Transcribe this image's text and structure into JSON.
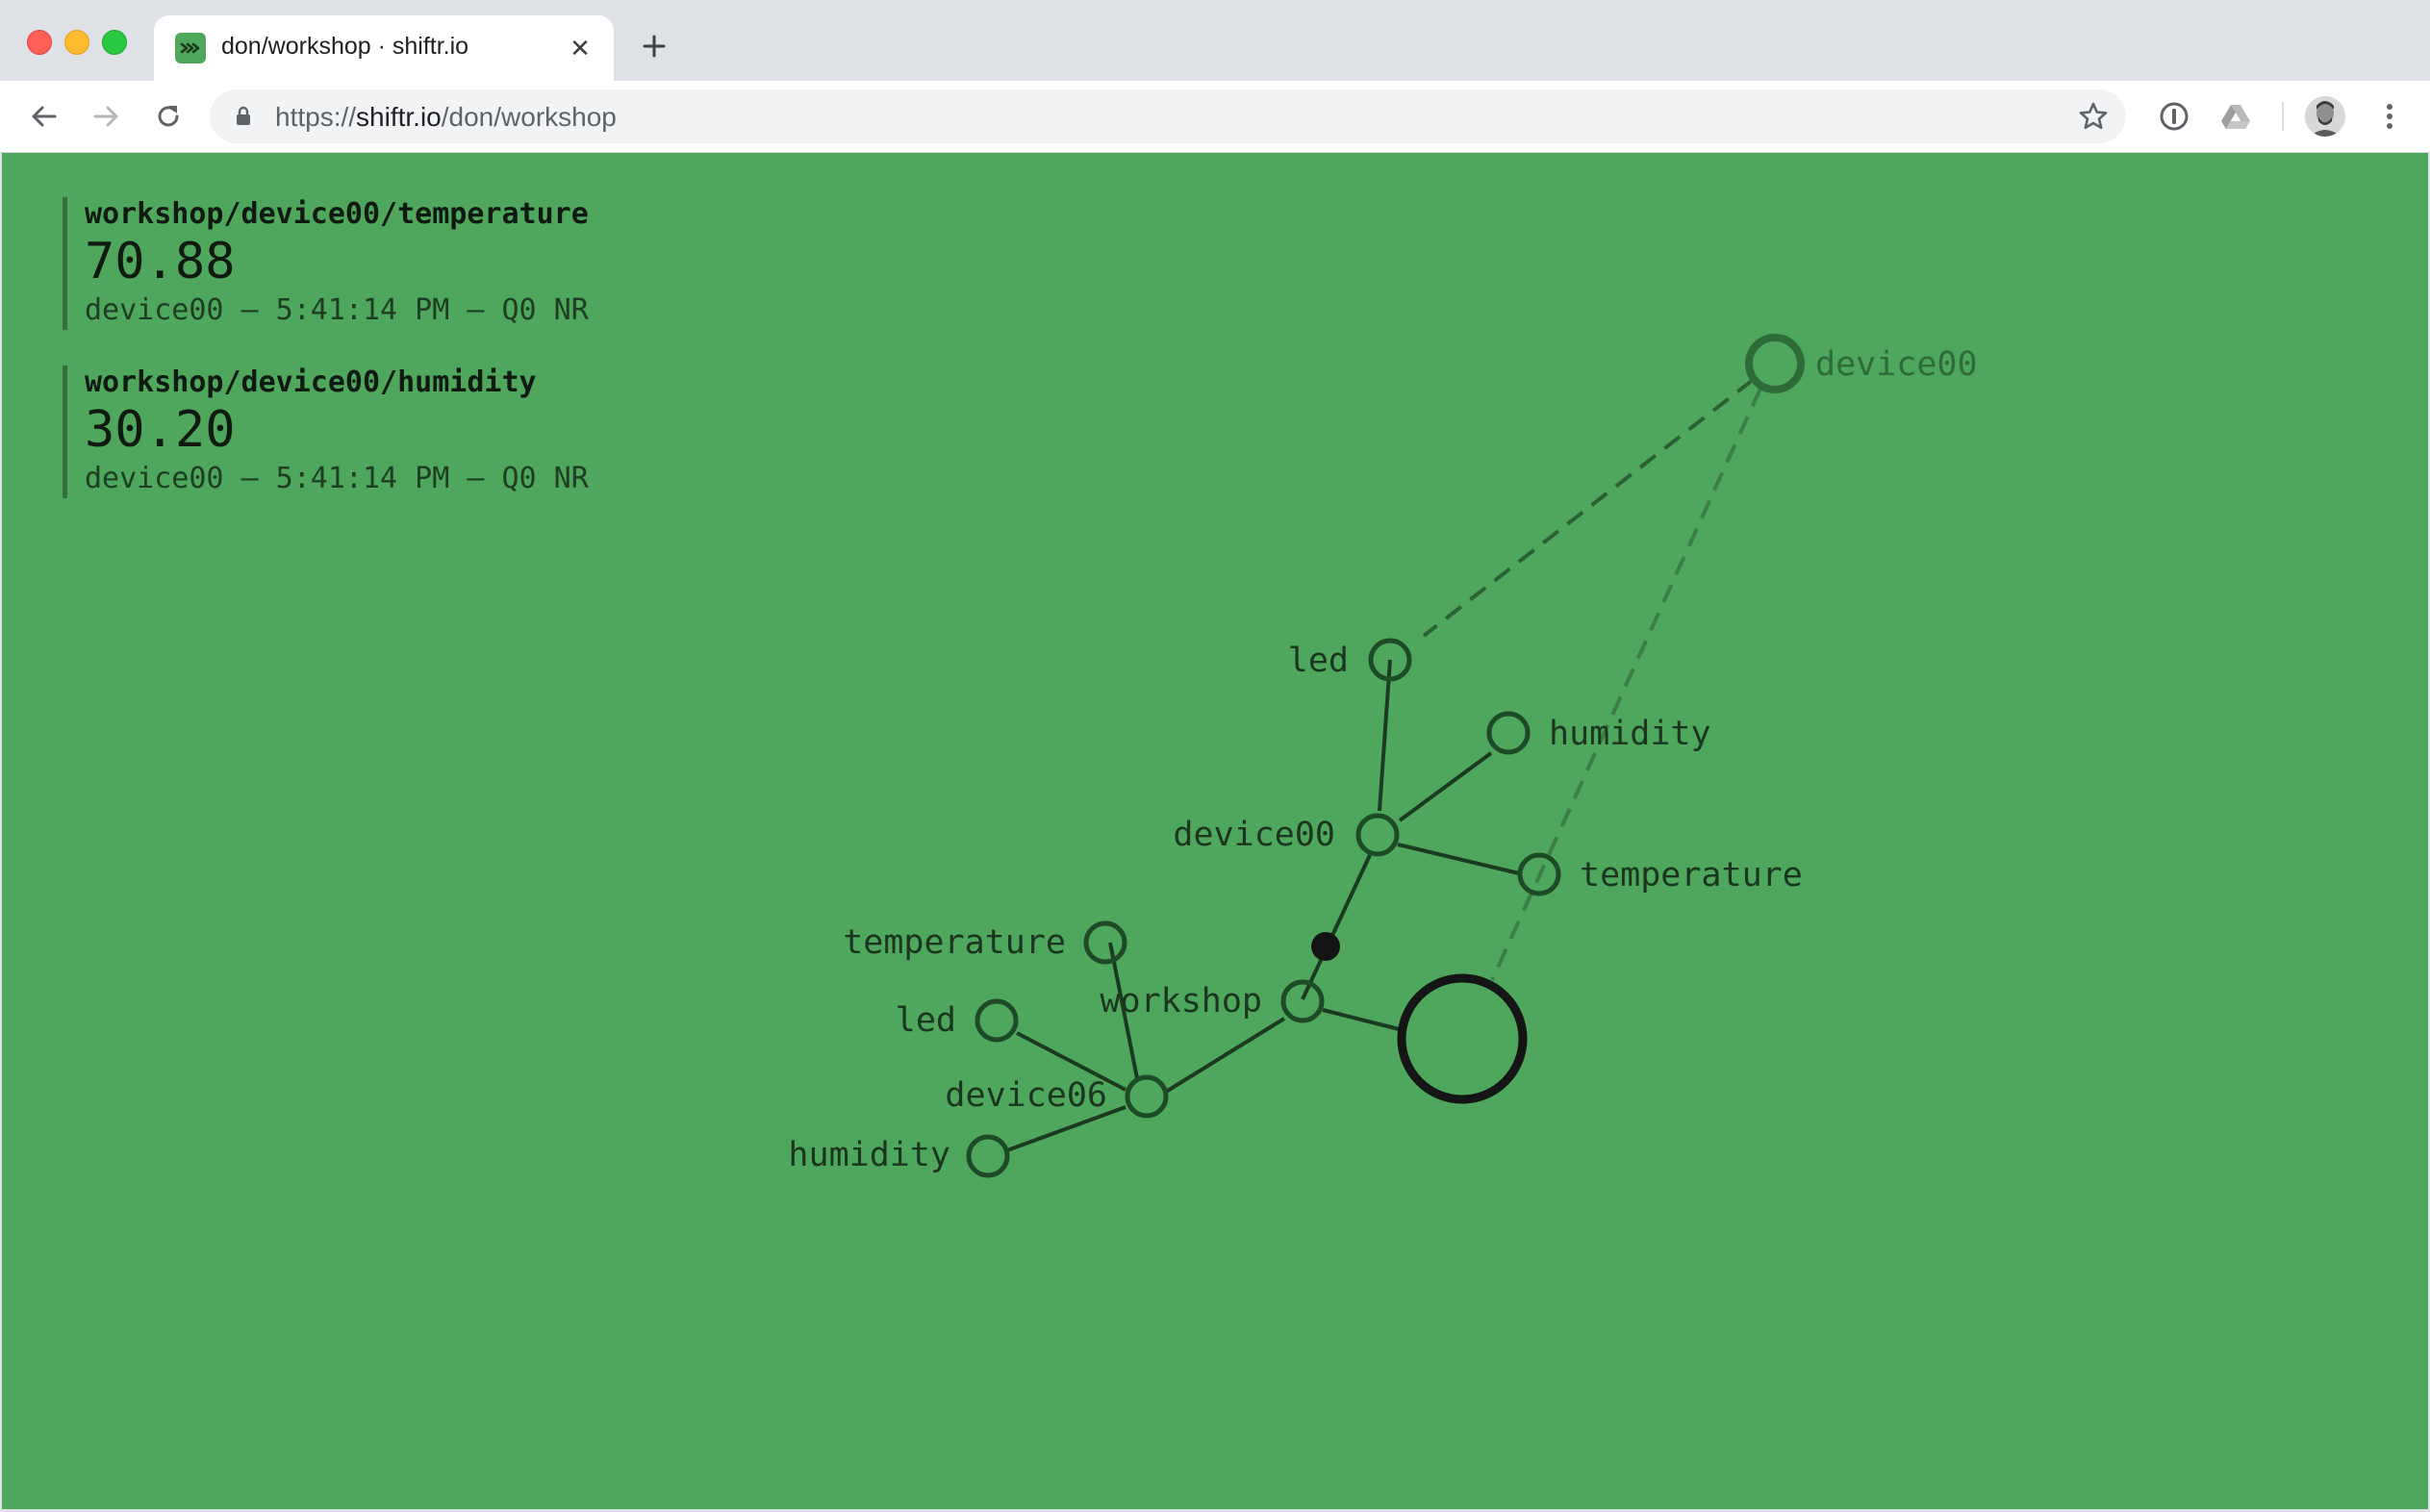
{
  "browser": {
    "tab": {
      "title": "don/workshop · shiftr.io",
      "close_glyph": "✕",
      "favicon_icon": "shiftr-logo-icon"
    },
    "new_tab_icon": "plus-icon",
    "url": {
      "scheme": "https://",
      "host": "shiftr.io",
      "path": "/don/workshop"
    },
    "icons": [
      "back-arrow-icon",
      "forward-arrow-icon",
      "reload-icon",
      "lock-icon",
      "star-icon",
      "password-extension-icon",
      "drive-extension-icon",
      "profile-avatar",
      "menu-dots-icon"
    ]
  },
  "messages": [
    {
      "topic": "workshop/device00/temperature",
      "value": "70.88",
      "meta": "device00 – 5:41:14 PM – Q0 NR"
    },
    {
      "topic": "workshop/device00/humidity",
      "value": "30.20",
      "meta": "device00 – 5:41:14 PM – Q0 NR"
    }
  ],
  "graph": {
    "nodes": [
      {
        "id": "client-device00",
        "label": "device00",
        "kind": "client"
      },
      {
        "id": "topic-led-00",
        "label": "led",
        "kind": "topic"
      },
      {
        "id": "topic-humidity-00",
        "label": "humidity",
        "kind": "topic"
      },
      {
        "id": "topic-device00",
        "label": "device00",
        "kind": "topic"
      },
      {
        "id": "topic-temperature-00",
        "label": "temperature",
        "kind": "topic"
      },
      {
        "id": "topic-temperature-06",
        "label": "temperature",
        "kind": "topic"
      },
      {
        "id": "topic-workshop",
        "label": "workshop",
        "kind": "topic"
      },
      {
        "id": "topic-led-06",
        "label": "led",
        "kind": "topic"
      },
      {
        "id": "topic-device06",
        "label": "device06",
        "kind": "topic"
      },
      {
        "id": "topic-humidity-06",
        "label": "humidity",
        "kind": "topic"
      },
      {
        "id": "root",
        "label": "",
        "kind": "root"
      },
      {
        "id": "message-dot",
        "label": "",
        "kind": "message"
      }
    ]
  },
  "colors": {
    "background": "#4ea75c",
    "node_stroke": "#1f4a27",
    "root_stroke": "#151515",
    "faded": "#2f6a39"
  }
}
